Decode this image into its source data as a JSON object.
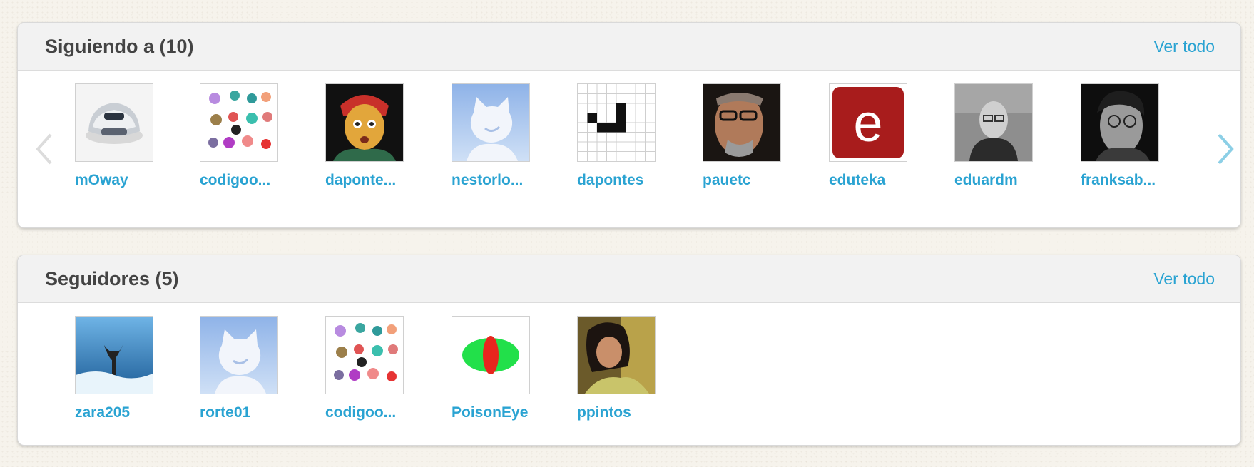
{
  "following": {
    "title": "Siguiendo a (10)",
    "see_all": "Ver todo",
    "users": [
      {
        "name": "mOway"
      },
      {
        "name": "codigoo..."
      },
      {
        "name": "daponte..."
      },
      {
        "name": "nestorlo..."
      },
      {
        "name": "dapontes"
      },
      {
        "name": "pauetc"
      },
      {
        "name": "eduteka"
      },
      {
        "name": "eduardm"
      },
      {
        "name": "franksab..."
      }
    ],
    "prev_icon": "chevron-left-icon",
    "next_icon": "chevron-right-icon"
  },
  "followers": {
    "title": "Seguidores (5)",
    "see_all": "Ver todo",
    "users": [
      {
        "name": "zara205"
      },
      {
        "name": "rorte01"
      },
      {
        "name": "codigoo..."
      },
      {
        "name": "PoisonEye"
      },
      {
        "name": "ppintos"
      }
    ]
  },
  "colors": {
    "link": "#2aa3d2",
    "title": "#444444",
    "header_bg": "#f2f2f2",
    "page_bg": "#f6f3ec",
    "arrow_disabled": "#dcdcdc",
    "arrow_active": "#8ccfe6"
  }
}
